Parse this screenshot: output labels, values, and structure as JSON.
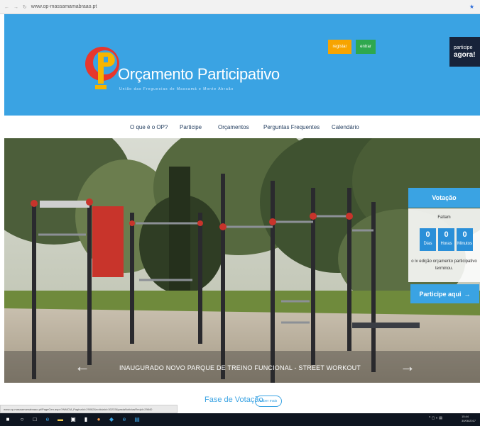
{
  "browser": {
    "url": "www.op-massamamabraao.pt"
  },
  "header": {
    "brand_title": "Orçamento Participativo",
    "brand_subtitle": "União das Freguesias de Massamá e Monte Abraão",
    "registar_label": "registar",
    "entrar_label": "entrar",
    "participe_line1": "participe",
    "participe_line2": "agora!"
  },
  "nav": {
    "items": [
      {
        "label": "O que é o OP?"
      },
      {
        "label": "Participe"
      },
      {
        "label": "Orçamentos"
      },
      {
        "label": "Perguntas Frequentes"
      },
      {
        "label": "Calendário"
      }
    ]
  },
  "hero": {
    "caption": "INAUGURADO NOVO PARQUE DE TREINO FUNCIONAL - STREET WORKOUT"
  },
  "vote": {
    "title": "Votação",
    "faltam": "Faltam",
    "counts": [
      {
        "num": "0",
        "unit": "Dias"
      },
      {
        "num": "0",
        "unit": "Horas"
      },
      {
        "num": "0",
        "unit": "Minutos"
      }
    ],
    "ended_text": "o iv edição orçamento participativo terminou.",
    "participe_button": "Participe aqui"
  },
  "below": {
    "fase_title": "Fase de Votação",
    "saber_mais": "saber mais"
  },
  "statusbar": {
    "text": "www.op-massamamabraao.pt/PageGen.aspx?WMCM_PaginaId=29082&noticiaId=30233&pastaNoticiasReqId=29840"
  },
  "taskbar": {
    "time": "15:44",
    "date": "30/06/2017"
  },
  "colors": {
    "header_blue": "#3aa3e3",
    "registar_orange": "#f7a400",
    "entrar_green": "#2ea84e",
    "participe_navy": "#17233a"
  }
}
